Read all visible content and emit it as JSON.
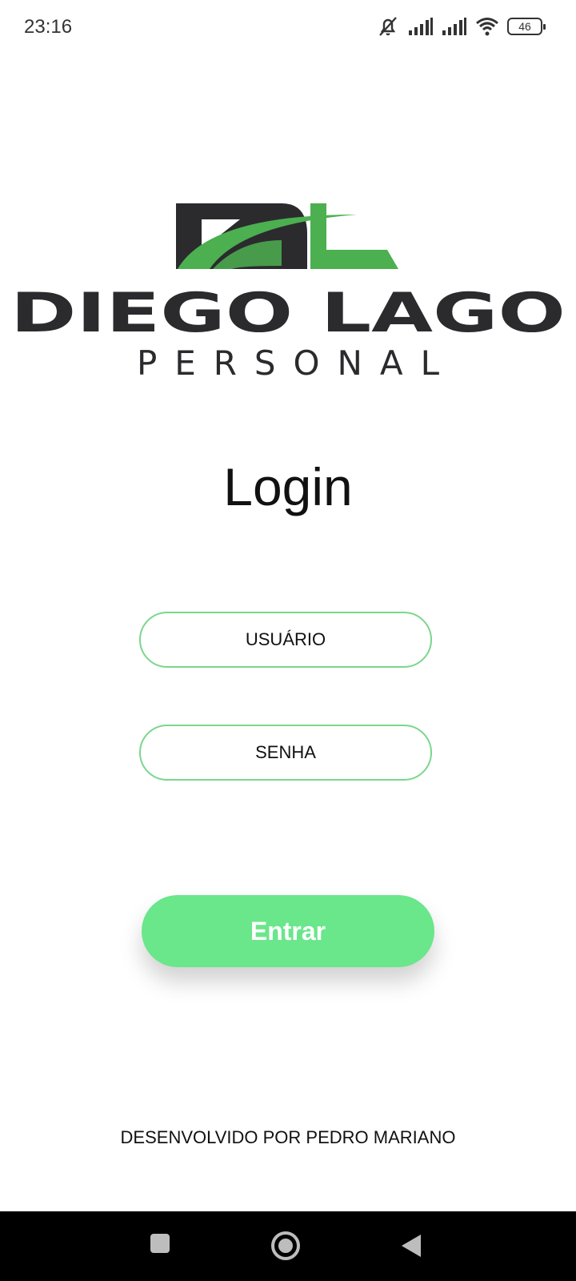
{
  "status_bar": {
    "time": "23:16",
    "battery": "46",
    "icons": [
      "mute-icon",
      "signal-icon",
      "signal-icon",
      "wifi-icon",
      "battery-icon"
    ]
  },
  "logo": {
    "monogram": "DL",
    "name": "DIEGO LAGO",
    "subtitle": "PERSONAL",
    "colors": {
      "dark": "#2b2b2e",
      "green": "#4caf50"
    }
  },
  "login": {
    "title": "Login",
    "username_placeholder": "USUÁRIO",
    "password_placeholder": "SENHA",
    "submit_label": "Entrar"
  },
  "footer": {
    "credit": "DESENVOLVIDO POR PEDRO MARIANO"
  },
  "nav": {
    "icons": [
      "recent-apps-icon",
      "home-icon",
      "back-icon"
    ]
  },
  "colors": {
    "accent": "#6ae68b",
    "field_border": "#7bd68d"
  }
}
